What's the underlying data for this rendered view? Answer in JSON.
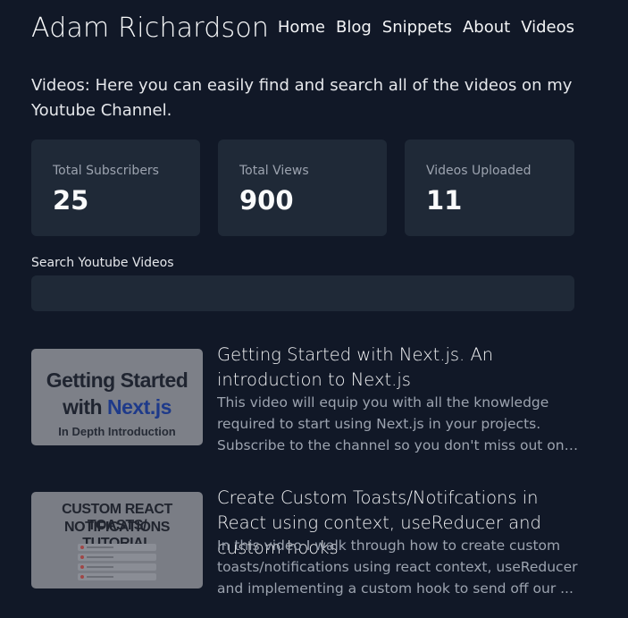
{
  "header": {
    "site_title": "Adam Richardson",
    "nav": [
      "Home",
      "Blog",
      "Snippets",
      "About",
      "Videos"
    ]
  },
  "intro": "Videos: Here you can easily find and search all of the videos on my Youtube Channel.",
  "stats": [
    {
      "label": "Total Subscribers",
      "value": "25"
    },
    {
      "label": "Total Views",
      "value": "900"
    },
    {
      "label": "Videos Uploaded",
      "value": "11"
    }
  ],
  "search": {
    "label": "Search Youtube Videos",
    "value": "",
    "placeholder": ""
  },
  "videos": [
    {
      "title": "Getting Started with Next.js. An introduction to Next.js",
      "description": "This video will equip you with all the knowledge required to start using Next.js in your projects. Subscribe to the channel so you don't miss out on upcoming full ...",
      "thumbnail": {
        "line1": "Getting Started",
        "line2_prefix": "with ",
        "line2_accent": "Next.js",
        "line3": "In Depth Introduction"
      }
    },
    {
      "title": "Create Custom Toasts/Notifcations in React using context, useReducer and custom hooks",
      "description": "In this video I walk through how to create custom toasts/notifications using react context, useReducer and implementing a custom hook to send off our ...",
      "thumbnail": {
        "line1": "CUSTOM REACT TOASTS/",
        "line2": "NOTIFICATIONS TUTORIAL"
      }
    }
  ],
  "colors": {
    "background": "#111827",
    "card": "#1f2937",
    "muted_text": "#9ca3af",
    "accent_next": "#1e3a8a"
  }
}
